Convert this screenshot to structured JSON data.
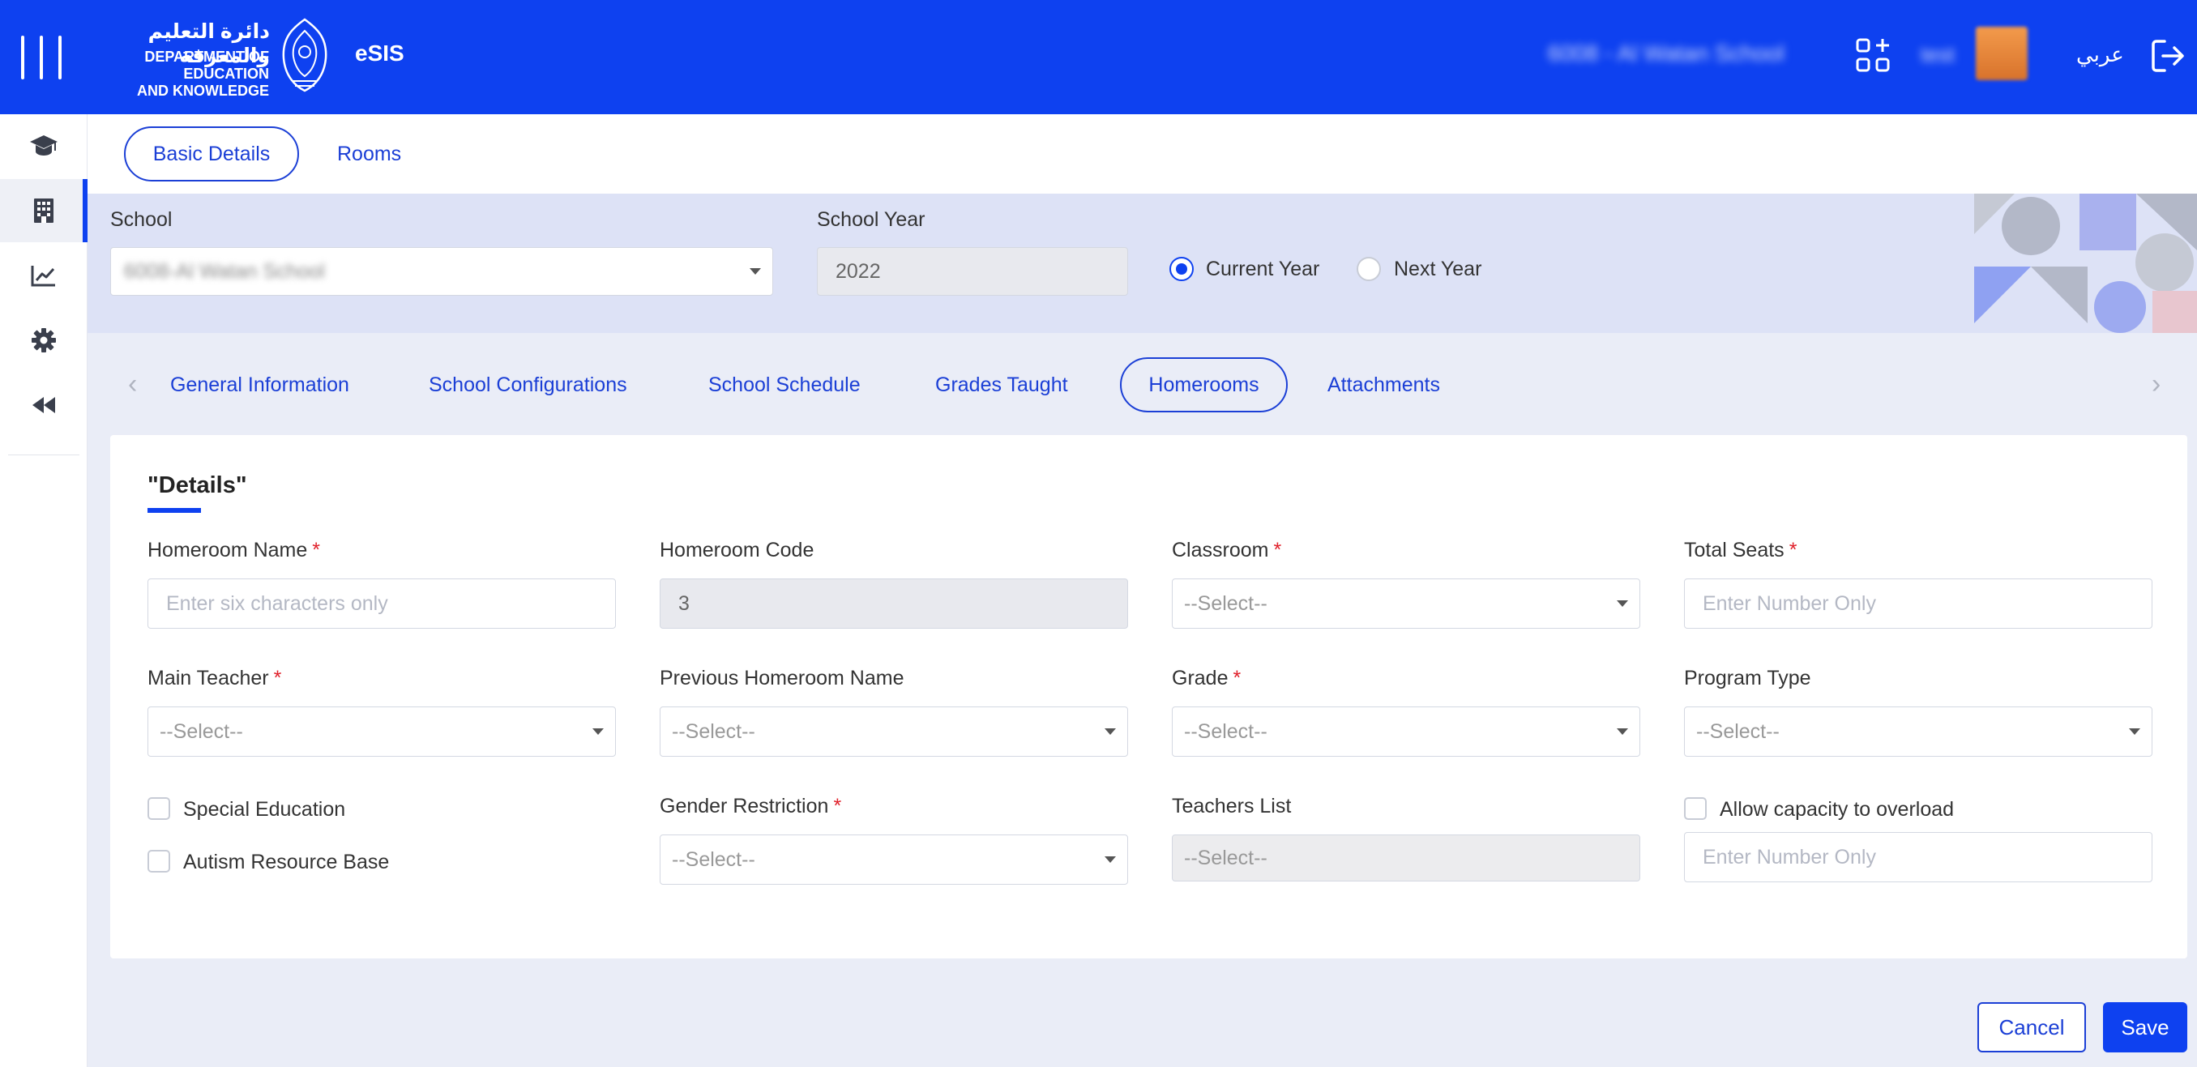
{
  "header": {
    "logo_arabic": "دائرة التعليم والمعرفة",
    "logo_english_line1": "DEPARTMENT OF EDUCATION",
    "logo_english_line2": "AND KNOWLEDGE",
    "app_name": "eSIS",
    "school_name": "6008 - Al Watan School",
    "user_name": "test",
    "language_toggle": "عربي"
  },
  "sidebar": {
    "items": [
      {
        "icon": "graduation-cap-icon"
      },
      {
        "icon": "building-icon",
        "active": true
      },
      {
        "icon": "chart-line-icon"
      },
      {
        "icon": "gear-icon"
      },
      {
        "icon": "rewind-icon"
      }
    ]
  },
  "top_tabs": [
    {
      "label": "Basic Details",
      "active": true
    },
    {
      "label": "Rooms",
      "active": false
    }
  ],
  "filters": {
    "school_label": "School",
    "school_value": "6008-Al Watan School",
    "year_label": "School Year",
    "year_value": "2022",
    "current_year_label": "Current Year",
    "next_year_label": "Next Year",
    "selected_year_option": "Current Year"
  },
  "section_tabs": [
    {
      "label": "General Information",
      "active": false
    },
    {
      "label": "School Configurations",
      "active": false
    },
    {
      "label": "School Schedule",
      "active": false
    },
    {
      "label": "Grades Taught",
      "active": false
    },
    {
      "label": "Homerooms",
      "active": true
    },
    {
      "label": "Attachments",
      "active": false
    }
  ],
  "details": {
    "title": "\"Details\"",
    "required_mark": "*",
    "homeroom_name_label": "Homeroom Name",
    "homeroom_name_placeholder": "Enter six characters only",
    "homeroom_code_label": "Homeroom Code",
    "homeroom_code_value": "3",
    "classroom_label": "Classroom",
    "total_seats_label": "Total Seats",
    "number_placeholder": "Enter Number Only",
    "main_teacher_label": "Main Teacher",
    "previous_homeroom_label": "Previous Homeroom Name",
    "grade_label": "Grade",
    "program_type_label": "Program Type",
    "special_education_label": "Special Education",
    "autism_resource_label": "Autism Resource Base",
    "gender_restriction_label": "Gender Restriction",
    "teachers_list_label": "Teachers List",
    "allow_overload_label": "Allow capacity to overload",
    "select_placeholder": "--Select--"
  },
  "actions": {
    "cancel_label": "Cancel",
    "save_label": "Save"
  },
  "colors": {
    "brand_blue": "#0e41f0",
    "required_red": "#e0202a",
    "band_background": "#dde2f6"
  }
}
